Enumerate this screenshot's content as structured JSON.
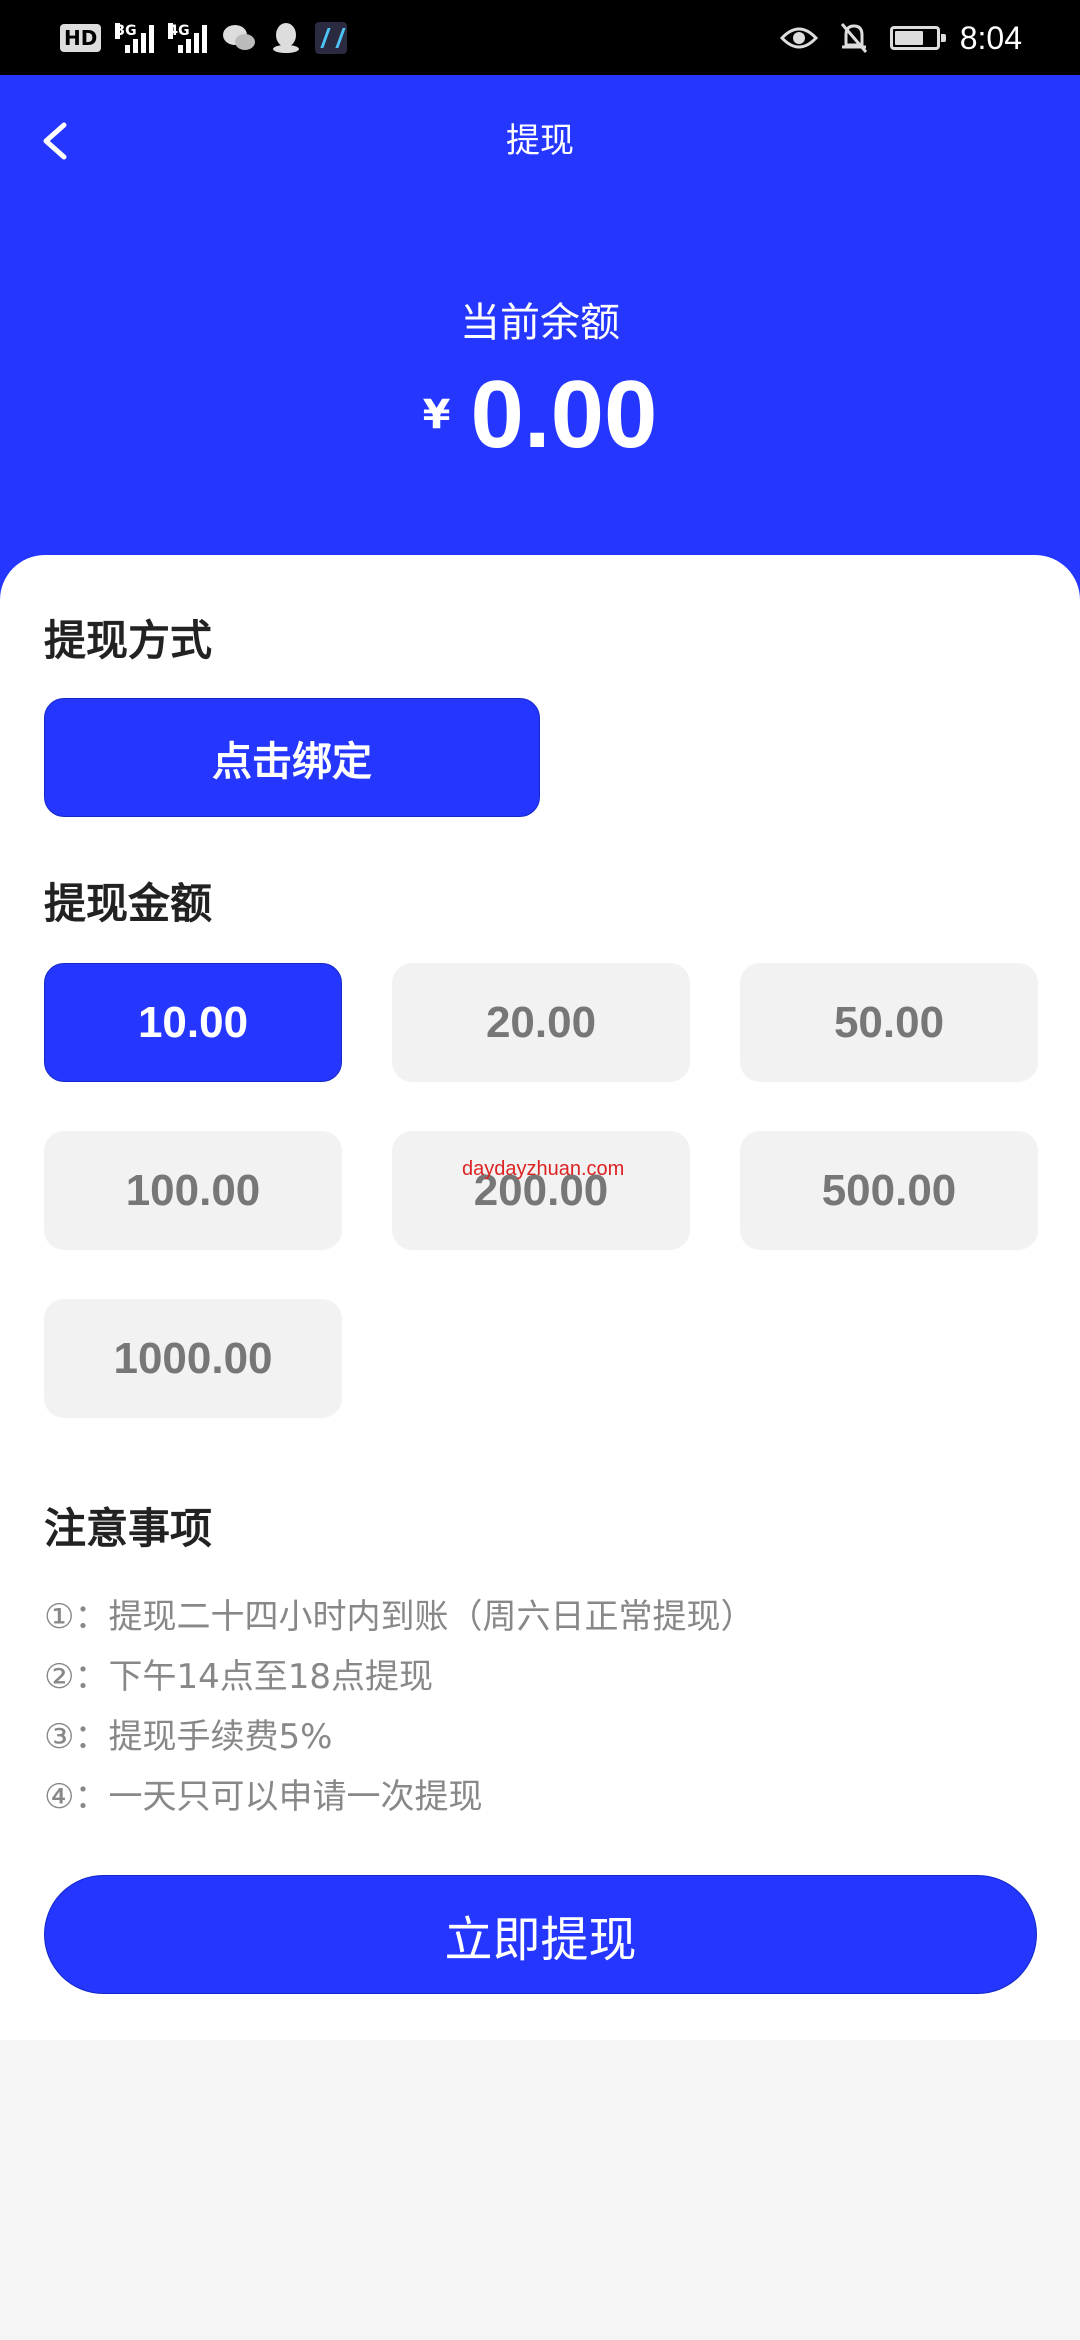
{
  "status_bar": {
    "hd_label": "HD",
    "network_1": "3G",
    "network_2": "4G",
    "time": "8:04",
    "battery_level": 0.7
  },
  "header": {
    "title": "提现",
    "balance_label": "当前余额",
    "currency_symbol": "¥",
    "balance": "0.00",
    "background_color": "#2537ff"
  },
  "withdraw_method": {
    "title": "提现方式",
    "bind_button_label": "点击绑定"
  },
  "withdraw_amount": {
    "title": "提现金额",
    "options": [
      {
        "label": "10.00",
        "selected": true
      },
      {
        "label": "20.00",
        "selected": false
      },
      {
        "label": "50.00",
        "selected": false
      },
      {
        "label": "100.00",
        "selected": false
      },
      {
        "label": "200.00",
        "selected": false
      },
      {
        "label": "500.00",
        "selected": false
      },
      {
        "label": "1000.00",
        "selected": false
      }
    ]
  },
  "watermark": "daydayzhuan.com",
  "notes": {
    "title": "注意事项",
    "items": [
      "①：提现二十四小时内到账（周六日正常提现）",
      "②：下午14点至18点提现",
      "③：提现手续费5%",
      "④：一天只可以申请一次提现"
    ]
  },
  "submit_button_label": "立即提现",
  "accent_color": "#2537ff"
}
